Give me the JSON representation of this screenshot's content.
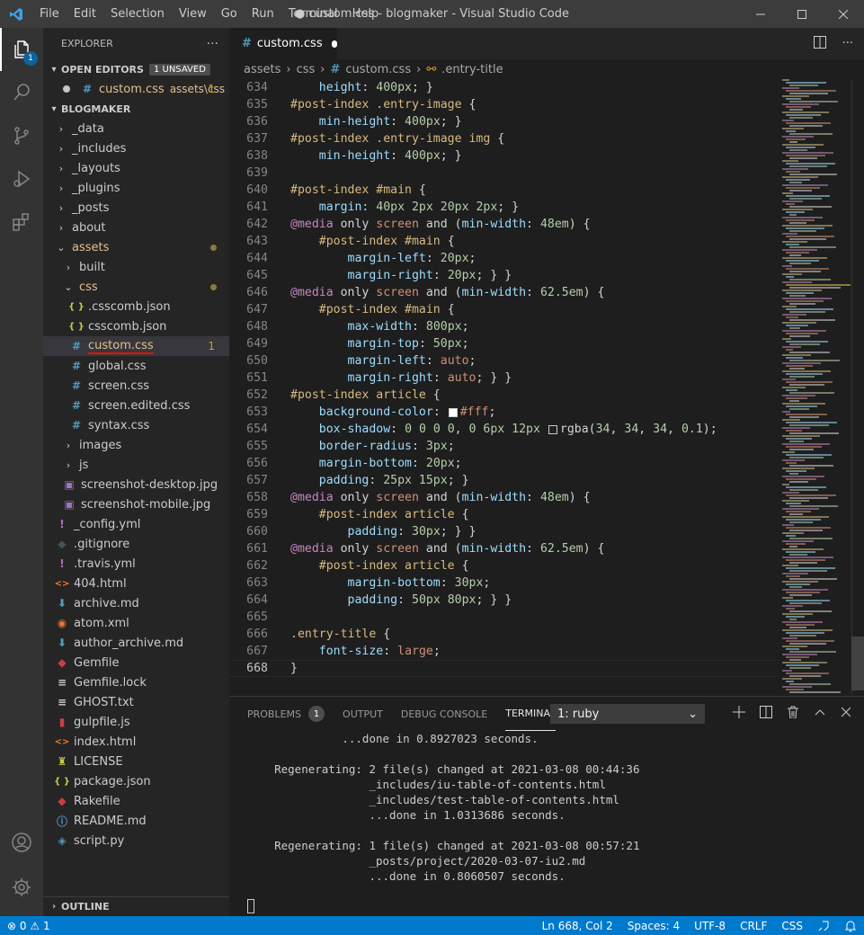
{
  "menu": [
    "File",
    "Edit",
    "Selection",
    "View",
    "Go",
    "Run",
    "Terminal",
    "Help"
  ],
  "window_title": "● custom.css - blogmaker - Visual Studio Code",
  "activity_badge": "1",
  "explorer": {
    "title": "EXPLORER",
    "more": "···",
    "open_editors_label": "OPEN EDITORS",
    "unsaved_badge": "1 UNSAVED",
    "open_file": "custom.css",
    "open_file_path": "assets\\css",
    "open_file_count": "1",
    "project": "BLOGMAKER",
    "tree": [
      {
        "label": "_data",
        "icon": "chevron",
        "type": "folder",
        "level": 0
      },
      {
        "label": "_includes",
        "icon": "chevron",
        "type": "folder",
        "level": 0
      },
      {
        "label": "_layouts",
        "icon": "chevron",
        "type": "folder",
        "level": 0
      },
      {
        "label": "_plugins",
        "icon": "chevron",
        "type": "folder",
        "level": 0
      },
      {
        "label": "_posts",
        "icon": "chevron",
        "type": "folder",
        "level": 0
      },
      {
        "label": "about",
        "icon": "chevron",
        "type": "folder",
        "level": 0
      },
      {
        "label": "assets",
        "icon": "chevron-open",
        "type": "folder",
        "level": 0,
        "color": "#e2c08d",
        "dot": true
      },
      {
        "label": "built",
        "icon": "chevron",
        "type": "folder",
        "level": 1
      },
      {
        "label": "css",
        "icon": "chevron-open",
        "type": "folder",
        "level": 1,
        "color": "#e2c08d",
        "dot": true
      },
      {
        "label": ".csscomb.json",
        "icon": "json",
        "type": "file",
        "level": 2
      },
      {
        "label": "csscomb.json",
        "icon": "json",
        "type": "file",
        "level": 2
      },
      {
        "label": "custom.css",
        "icon": "css",
        "type": "file",
        "level": 2,
        "color": "#e2c08d",
        "count": "1",
        "selected": true
      },
      {
        "label": "global.css",
        "icon": "css",
        "type": "file",
        "level": 2
      },
      {
        "label": "screen.css",
        "icon": "css",
        "type": "file",
        "level": 2
      },
      {
        "label": "screen.edited.css",
        "icon": "css",
        "type": "file",
        "level": 2
      },
      {
        "label": "syntax.css",
        "icon": "css",
        "type": "file",
        "level": 2
      },
      {
        "label": "images",
        "icon": "chevron",
        "type": "folder",
        "level": 1
      },
      {
        "label": "js",
        "icon": "chevron",
        "type": "folder",
        "level": 1
      },
      {
        "label": "screenshot-desktop.jpg",
        "icon": "image",
        "type": "file",
        "level": 1
      },
      {
        "label": "screenshot-mobile.jpg",
        "icon": "image",
        "type": "file",
        "level": 1
      },
      {
        "label": "_config.yml",
        "icon": "yml",
        "type": "file",
        "level": 0
      },
      {
        "label": ".gitignore",
        "icon": "git",
        "type": "file",
        "level": 0
      },
      {
        "label": ".travis.yml",
        "icon": "yml",
        "type": "file",
        "level": 0
      },
      {
        "label": "404.html",
        "icon": "html",
        "type": "file",
        "level": 0
      },
      {
        "label": "archive.md",
        "icon": "md",
        "type": "file",
        "level": 0
      },
      {
        "label": "atom.xml",
        "icon": "rss",
        "type": "file",
        "level": 0
      },
      {
        "label": "author_archive.md",
        "icon": "md",
        "type": "file",
        "level": 0
      },
      {
        "label": "Gemfile",
        "icon": "ruby",
        "type": "file",
        "level": 0
      },
      {
        "label": "Gemfile.lock",
        "icon": "lines",
        "type": "file",
        "level": 0
      },
      {
        "label": "GHOST.txt",
        "icon": "lines",
        "type": "file",
        "level": 0
      },
      {
        "label": "gulpfile.js",
        "icon": "gulp",
        "type": "file",
        "level": 0
      },
      {
        "label": "index.html",
        "icon": "html",
        "type": "file",
        "level": 0
      },
      {
        "label": "LICENSE",
        "icon": "license",
        "type": "file",
        "level": 0
      },
      {
        "label": "package.json",
        "icon": "json",
        "type": "file",
        "level": 0
      },
      {
        "label": "Rakefile",
        "icon": "ruby",
        "type": "file",
        "level": 0
      },
      {
        "label": "README.md",
        "icon": "info",
        "type": "file",
        "level": 0
      },
      {
        "label": "script.py",
        "icon": "python",
        "type": "file",
        "level": 0
      }
    ],
    "outline_label": "OUTLINE"
  },
  "editor": {
    "tab_label": "custom.css",
    "breadcrumb": [
      "assets",
      "css",
      "custom.css",
      ".entry-title"
    ],
    "lines": [
      {
        "n": "634",
        "tokens": [
          [
            "w",
            "    "
          ],
          [
            "p",
            "height"
          ],
          [
            "w",
            ": "
          ],
          [
            "v",
            "400px"
          ],
          [
            "w",
            "; }"
          ]
        ]
      },
      {
        "n": "635",
        "tokens": [
          [
            "s",
            "#post-index .entry-image"
          ],
          [
            "w",
            " {"
          ]
        ]
      },
      {
        "n": "636",
        "tokens": [
          [
            "w",
            "    "
          ],
          [
            "p",
            "min-height"
          ],
          [
            "w",
            ": "
          ],
          [
            "v",
            "400px"
          ],
          [
            "w",
            "; }"
          ]
        ]
      },
      {
        "n": "637",
        "tokens": [
          [
            "s",
            "#post-index .entry-image img"
          ],
          [
            "w",
            " {"
          ]
        ]
      },
      {
        "n": "638",
        "tokens": [
          [
            "w",
            "    "
          ],
          [
            "p",
            "min-height"
          ],
          [
            "w",
            ": "
          ],
          [
            "v",
            "400px"
          ],
          [
            "w",
            "; }"
          ]
        ]
      },
      {
        "n": "639",
        "tokens": []
      },
      {
        "n": "640",
        "tokens": [
          [
            "s",
            "#post-index #main"
          ],
          [
            "w",
            " {"
          ]
        ]
      },
      {
        "n": "641",
        "tokens": [
          [
            "w",
            "    "
          ],
          [
            "p",
            "margin"
          ],
          [
            "w",
            ": "
          ],
          [
            "v",
            "40px 2px 20px 2px"
          ],
          [
            "w",
            "; }"
          ]
        ]
      },
      {
        "n": "642",
        "tokens": [
          [
            "k",
            "@media"
          ],
          [
            "w",
            " "
          ],
          [
            "w",
            "only "
          ],
          [
            "t",
            "screen"
          ],
          [
            "w",
            " and ("
          ],
          [
            "p",
            "min-width"
          ],
          [
            "w",
            ": "
          ],
          [
            "v",
            "48em"
          ],
          [
            "w",
            ") {"
          ]
        ]
      },
      {
        "n": "643",
        "tokens": [
          [
            "w",
            "    "
          ],
          [
            "s",
            "#post-index #main"
          ],
          [
            "w",
            " {"
          ]
        ]
      },
      {
        "n": "644",
        "tokens": [
          [
            "w",
            "        "
          ],
          [
            "p",
            "margin-left"
          ],
          [
            "w",
            ": "
          ],
          [
            "v",
            "20px"
          ],
          [
            "w",
            ";"
          ]
        ]
      },
      {
        "n": "645",
        "tokens": [
          [
            "w",
            "        "
          ],
          [
            "p",
            "margin-right"
          ],
          [
            "w",
            ": "
          ],
          [
            "v",
            "20px"
          ],
          [
            "w",
            "; } }"
          ]
        ]
      },
      {
        "n": "646",
        "tokens": [
          [
            "k",
            "@media"
          ],
          [
            "w",
            " "
          ],
          [
            "w",
            "only "
          ],
          [
            "t",
            "screen"
          ],
          [
            "w",
            " and ("
          ],
          [
            "p",
            "min-width"
          ],
          [
            "w",
            ": "
          ],
          [
            "v",
            "62.5em"
          ],
          [
            "w",
            ") {"
          ]
        ]
      },
      {
        "n": "647",
        "tokens": [
          [
            "w",
            "    "
          ],
          [
            "s",
            "#post-index #main"
          ],
          [
            "w",
            " {"
          ]
        ]
      },
      {
        "n": "648",
        "tokens": [
          [
            "w",
            "        "
          ],
          [
            "p",
            "max-width"
          ],
          [
            "w",
            ": "
          ],
          [
            "v",
            "800px"
          ],
          [
            "w",
            ";"
          ]
        ]
      },
      {
        "n": "649",
        "tokens": [
          [
            "w",
            "        "
          ],
          [
            "p",
            "margin-top"
          ],
          [
            "w",
            ": "
          ],
          [
            "v",
            "50px"
          ],
          [
            "w",
            ";"
          ]
        ]
      },
      {
        "n": "650",
        "tokens": [
          [
            "w",
            "        "
          ],
          [
            "p",
            "margin-left"
          ],
          [
            "w",
            ": "
          ],
          [
            "t",
            "auto"
          ],
          [
            "w",
            ";"
          ]
        ]
      },
      {
        "n": "651",
        "tokens": [
          [
            "w",
            "        "
          ],
          [
            "p",
            "margin-right"
          ],
          [
            "w",
            ": "
          ],
          [
            "t",
            "auto"
          ],
          [
            "w",
            "; } }"
          ]
        ]
      },
      {
        "n": "652",
        "tokens": [
          [
            "s",
            "#post-index article"
          ],
          [
            "w",
            " {"
          ]
        ]
      },
      {
        "n": "653",
        "tokens": [
          [
            "w",
            "    "
          ],
          [
            "p",
            "background-color"
          ],
          [
            "w",
            ": "
          ],
          [
            "sw",
            "#ffffff"
          ],
          [
            "t",
            "#fff"
          ],
          [
            "w",
            ";"
          ]
        ]
      },
      {
        "n": "654",
        "tokens": [
          [
            "w",
            "    "
          ],
          [
            "p",
            "box-shadow"
          ],
          [
            "w",
            ": "
          ],
          [
            "v",
            "0 0 0 0"
          ],
          [
            "w",
            ", "
          ],
          [
            "v",
            "0 6px 12px"
          ],
          [
            "w",
            " "
          ],
          [
            "sw",
            "#222222"
          ],
          [
            "w",
            "rgba("
          ],
          [
            "v",
            "34"
          ],
          [
            "w",
            ", "
          ],
          [
            "v",
            "34"
          ],
          [
            "w",
            ", "
          ],
          [
            "v",
            "34"
          ],
          [
            "w",
            ", "
          ],
          [
            "v",
            "0.1"
          ],
          [
            "w",
            ");"
          ]
        ]
      },
      {
        "n": "655",
        "tokens": [
          [
            "w",
            "    "
          ],
          [
            "p",
            "border-radius"
          ],
          [
            "w",
            ": "
          ],
          [
            "v",
            "3px"
          ],
          [
            "w",
            ";"
          ]
        ]
      },
      {
        "n": "656",
        "tokens": [
          [
            "w",
            "    "
          ],
          [
            "p",
            "margin-bottom"
          ],
          [
            "w",
            ": "
          ],
          [
            "v",
            "20px"
          ],
          [
            "w",
            ";"
          ]
        ]
      },
      {
        "n": "657",
        "tokens": [
          [
            "w",
            "    "
          ],
          [
            "p",
            "padding"
          ],
          [
            "w",
            ": "
          ],
          [
            "v",
            "25px 15px"
          ],
          [
            "w",
            "; }"
          ]
        ]
      },
      {
        "n": "658",
        "tokens": [
          [
            "k",
            "@media"
          ],
          [
            "w",
            " "
          ],
          [
            "w",
            "only "
          ],
          [
            "t",
            "screen"
          ],
          [
            "w",
            " and ("
          ],
          [
            "p",
            "min-width"
          ],
          [
            "w",
            ": "
          ],
          [
            "v",
            "48em"
          ],
          [
            "w",
            ") {"
          ]
        ]
      },
      {
        "n": "659",
        "tokens": [
          [
            "w",
            "    "
          ],
          [
            "s",
            "#post-index article"
          ],
          [
            "w",
            " {"
          ]
        ]
      },
      {
        "n": "660",
        "tokens": [
          [
            "w",
            "        "
          ],
          [
            "p",
            "padding"
          ],
          [
            "w",
            ": "
          ],
          [
            "v",
            "30px"
          ],
          [
            "w",
            "; } }"
          ]
        ]
      },
      {
        "n": "661",
        "tokens": [
          [
            "k",
            "@media"
          ],
          [
            "w",
            " "
          ],
          [
            "w",
            "only "
          ],
          [
            "t",
            "screen"
          ],
          [
            "w",
            " and ("
          ],
          [
            "p",
            "min-width"
          ],
          [
            "w",
            ": "
          ],
          [
            "v",
            "62.5em"
          ],
          [
            "w",
            ") {"
          ]
        ]
      },
      {
        "n": "662",
        "tokens": [
          [
            "w",
            "    "
          ],
          [
            "s",
            "#post-index article"
          ],
          [
            "w",
            " {"
          ]
        ]
      },
      {
        "n": "663",
        "tokens": [
          [
            "w",
            "        "
          ],
          [
            "p",
            "margin-bottom"
          ],
          [
            "w",
            ": "
          ],
          [
            "v",
            "30px"
          ],
          [
            "w",
            ";"
          ]
        ]
      },
      {
        "n": "664",
        "tokens": [
          [
            "w",
            "        "
          ],
          [
            "p",
            "padding"
          ],
          [
            "w",
            ": "
          ],
          [
            "v",
            "50px 80px"
          ],
          [
            "w",
            "; } }"
          ]
        ]
      },
      {
        "n": "665",
        "tokens": []
      },
      {
        "n": "666",
        "tokens": [
          [
            "s",
            ".entry-title"
          ],
          [
            "w",
            " {"
          ]
        ]
      },
      {
        "n": "667",
        "tokens": [
          [
            "w",
            "    "
          ],
          [
            "p",
            "font-size"
          ],
          [
            "w",
            ": "
          ],
          [
            "t",
            "large"
          ],
          [
            "w",
            ";"
          ]
        ]
      },
      {
        "n": "668",
        "tokens": [
          [
            "w",
            "}"
          ]
        ],
        "current": true
      }
    ]
  },
  "panel": {
    "tabs": [
      {
        "label": "PROBLEMS",
        "badge": "1"
      },
      {
        "label": "OUTPUT"
      },
      {
        "label": "DEBUG CONSOLE"
      },
      {
        "label": "TERMINAL",
        "active": true
      }
    ],
    "terminal_select": "1: ruby",
    "terminal_lines": [
      "              ...done in 0.8927023 seconds.",
      "",
      "    Regenerating: 2 file(s) changed at 2021-03-08 00:44:36",
      "                  _includes/iu-table-of-contents.html",
      "                  _includes/test-table-of-contents.html",
      "                  ...done in 1.0313686 seconds.",
      "",
      "    Regenerating: 1 file(s) changed at 2021-03-08 00:57:21",
      "                  _posts/project/2020-03-07-iu2.md",
      "                  ...done in 0.8060507 seconds."
    ]
  },
  "status": {
    "errors": "0",
    "warnings": "1",
    "position": "Ln 668, Col 2",
    "spaces": "Spaces: 4",
    "encoding": "UTF-8",
    "eol": "CRLF",
    "language": "CSS"
  },
  "colors": {
    "status_bg": "#007acc",
    "accent": "#0e639c",
    "modified": "#e2c08d"
  }
}
